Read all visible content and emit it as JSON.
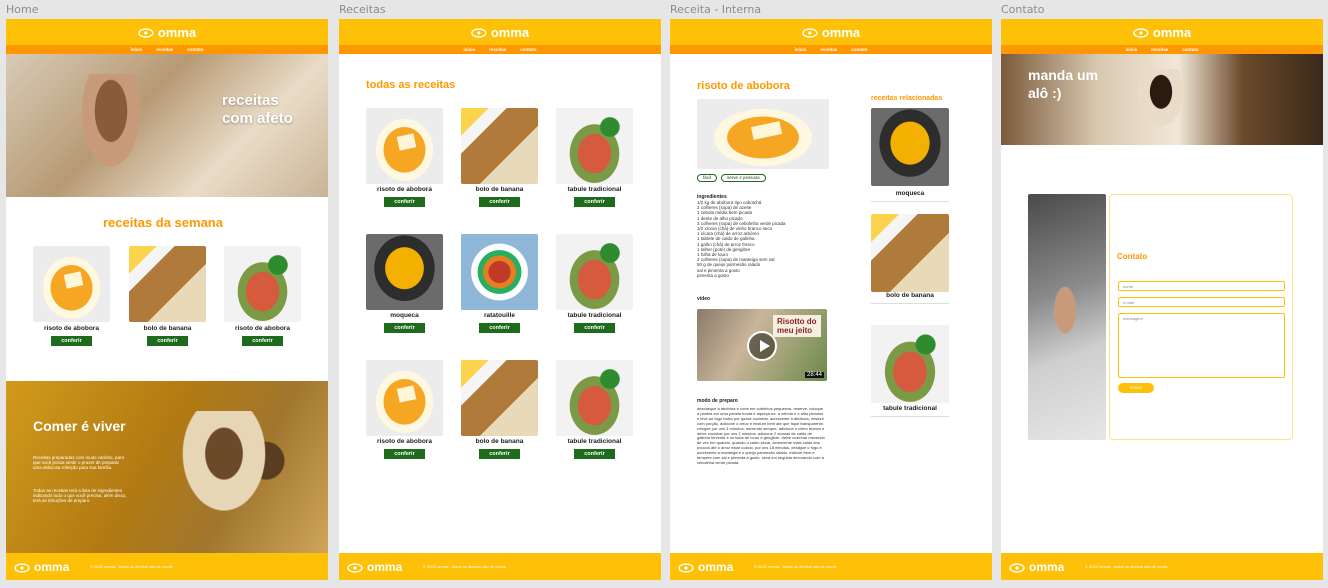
{
  "brand": {
    "name": "omma",
    "primary": "#ffc107",
    "secondary": "#ff9800",
    "button": "#1e6b1e"
  },
  "nav": [
    "início",
    "receitas",
    "contato"
  ],
  "footer": {
    "copyright": "© 2022 omma - todos os direitos são de vocês"
  },
  "frames": {
    "home": "Home",
    "receitas": "Receitas",
    "interna": "Receita - Interna",
    "contato": "Contato"
  },
  "home": {
    "hero_title_1": "receitas",
    "hero_title_2": "com afeto",
    "week_title": "receitas da  semana",
    "cards": [
      {
        "label": "risoto de abobora",
        "button": "conferir"
      },
      {
        "label": "bolo de banana",
        "button": "conferir"
      },
      {
        "label": "risoto de abobora",
        "button": "conferir"
      }
    ],
    "about_title": "Comer é viver",
    "about_p1": "Receitas preparadas com muito carinho, para que você possa sentir o prazer de preparar uma deliciosa refeição para sua família.",
    "about_p2": "Todas as receitas terá a lista de ingredientes indicando tudo o que você precisa, além disso, terá as intruções de preparo."
  },
  "receitas": {
    "title": "todas as receitas",
    "cards": [
      {
        "label": "risoto de abobora",
        "button": "conferir"
      },
      {
        "label": "bolo de banana",
        "button": "conferir"
      },
      {
        "label": "tabule tradicional",
        "button": "conferir"
      },
      {
        "label": "moqueca",
        "button": "conferir"
      },
      {
        "label": "ratatouille",
        "button": "conferir"
      },
      {
        "label": "tabule tradicional",
        "button": "conferir"
      },
      {
        "label": "risoto de abobora",
        "button": "conferir"
      },
      {
        "label": "bolo de banana",
        "button": "conferir"
      },
      {
        "label": "tabule tradicional",
        "button": "conferir"
      }
    ]
  },
  "interna": {
    "title": "risoto de abobora",
    "tags": [
      "fácil",
      "serve 4 pessoas"
    ],
    "ingredients_title": "ingredientes",
    "ingredients": [
      "1/2 kg de abóbora tipo cabotchá",
      "2 colheres (sopa) de azeite",
      "1 cebola média bem picada",
      "1 dente de alho picado",
      "3 colheres (sopa) de cebolinha verde picada",
      "1/2 xícara (chá) de vinho branco seco",
      "1 xícara (chá) de arroz arbóreo",
      "1 tablete de caldo de galinha",
      "1 galho (chá) de arroz fresco",
      "1 talher (pote) de gengibre",
      "1 folha de louro",
      "2 colheres (sopa) de manteiga sem sal",
      "50 g de queijo parmesão ralado",
      "sal e pimenta a gosto",
      "pimenta a gosto"
    ],
    "video_title": "vídeo",
    "video_caption": "Risotto do meu jeito",
    "video_duration": "28:44",
    "preparo_title": "modo de preparo",
    "preparo_text": "descasque a abóbora e corte em cubinhos pequenos. reserve. coloque a panela em uma panela funda e aqueça-na. a cebola e o alho picados e leve ao fogo baixo por quase cozinhar. acrescente a abóbora, misture com porção, adicione o arroz e misture bem até que fique transparente. refogue por uns 3 minutos, mexendo sempre. adicione o vinho branco e deixe cozinhar por uns 2 minutos. adicione 2 xícaras de caldo de galinha fervente e os talos de louro e gengibre. deixe cozinhar mexendo de vez em quando. quando o caldo secar, acrescente mais caldo aos poucos até o arroz estar cozido, por uns 18 minutos. desligue o fogo e acrescente a manteiga e o queijo parmesão ralado. misture bem e tempere com sal e pimenta a gosto. sirva em seguida decorando com a cebolinha verde picada.",
    "related_title": "receitas relacionadas",
    "related": [
      "moqueca",
      "bolo de banana",
      "tabule tradicional"
    ]
  },
  "contato": {
    "hero_title_1": "manda um",
    "hero_title_2": "alô :)",
    "form_title": "Contato",
    "name_placeholder": "nome",
    "email_placeholder": "e-mail",
    "message_placeholder": "mensagem",
    "submit": "enviar"
  }
}
